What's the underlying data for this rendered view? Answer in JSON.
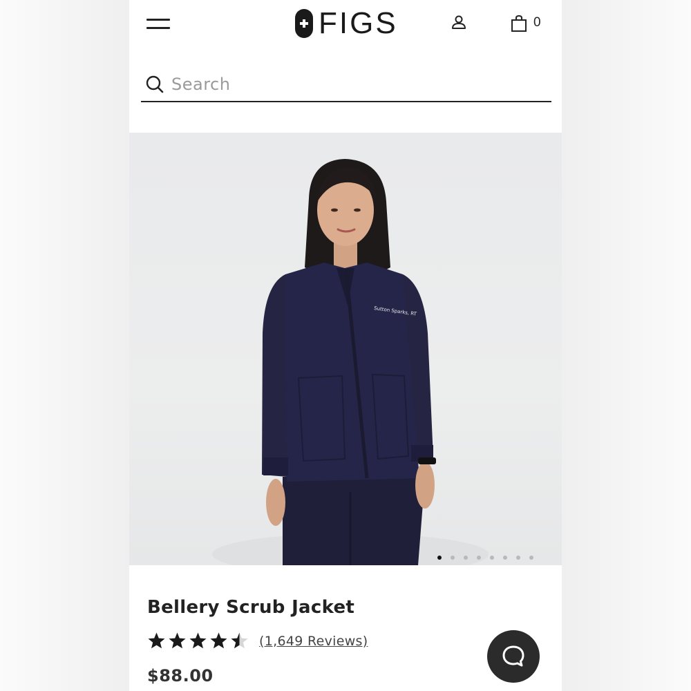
{
  "header": {
    "brand": "FIGS",
    "cart_count": "0",
    "icons": [
      "menu-icon",
      "figs-logo-mark",
      "account-icon",
      "shopping-bag-icon"
    ]
  },
  "search": {
    "placeholder": "Search",
    "value": ""
  },
  "gallery": {
    "image_count": 8,
    "active_index": 0,
    "embroidery_text": "Sutton Sparks, RT",
    "jacket_color": "#23233f"
  },
  "product": {
    "title": "Bellery Scrub Jacket",
    "rating": 4.5,
    "rating_max": 5,
    "reviews_label": "(1,649 Reviews)",
    "price": "$88.00"
  },
  "chat": {
    "icon": "chat-bubble-icon"
  },
  "colors": {
    "text": "#222222",
    "chat_button": "#2b2b2b",
    "image_bg": "#e9eaec"
  }
}
